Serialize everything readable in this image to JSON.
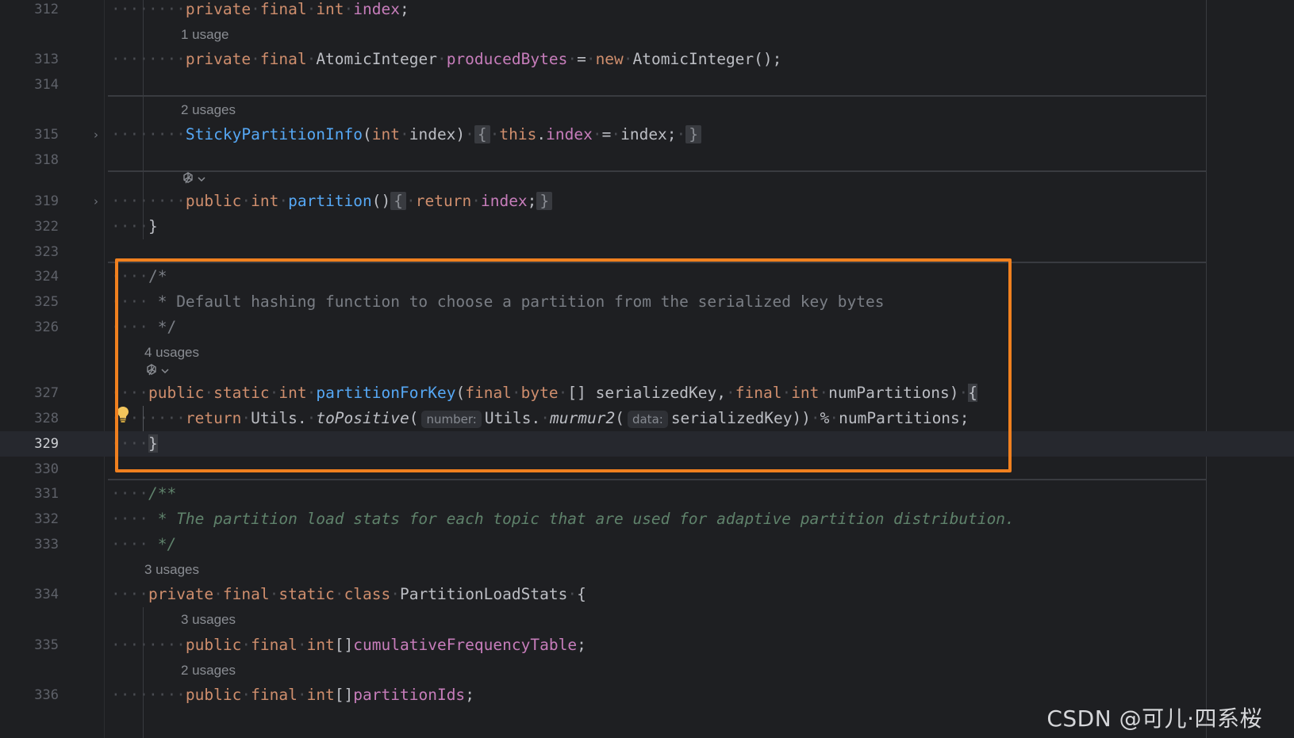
{
  "editor": {
    "lines": [
      {
        "num": "312",
        "indent": 2,
        "tokens": [
          [
            "kw",
            "private"
          ],
          [
            "kw",
            "final"
          ],
          [
            "kw",
            "int"
          ],
          [
            "fld",
            "index"
          ],
          [
            "p",
            ";"
          ]
        ]
      },
      {
        "num": "313",
        "indent": 2,
        "tokens": [
          [
            "kw",
            "private"
          ],
          [
            "kw",
            "final"
          ],
          [
            "p",
            "AtomicInteger"
          ],
          [
            "fld",
            "producedBytes"
          ],
          [
            "p",
            "="
          ],
          [
            "kw",
            "new"
          ],
          [
            "p",
            "AtomicInteger();"
          ]
        ]
      },
      {
        "num": "314"
      },
      {
        "num": "315",
        "indent": 2,
        "fold": true,
        "tokens": [
          [
            "fn",
            "StickyPartitionInfo"
          ],
          [
            "p",
            "("
          ],
          [
            "kw",
            "int"
          ],
          [
            "p",
            "index)"
          ],
          [
            "fb",
            "{"
          ],
          [
            "kw",
            "this"
          ],
          [
            "p",
            "."
          ],
          [
            "fld",
            "index"
          ],
          [
            "p",
            "="
          ],
          [
            "p",
            "index;"
          ],
          [
            "fb",
            "}"
          ]
        ]
      },
      {
        "num": "318"
      },
      {
        "num": "319",
        "indent": 2,
        "fold": true,
        "tokens": [
          [
            "kw",
            "public"
          ],
          [
            "kw",
            "int"
          ],
          [
            "fn",
            "partition"
          ],
          [
            "p",
            "()"
          ],
          [
            "fb",
            "{"
          ],
          [
            "kw",
            "return"
          ],
          [
            "fld",
            "index"
          ],
          [
            "p",
            ";"
          ],
          [
            "fb",
            "}"
          ]
        ]
      },
      {
        "num": "322",
        "indent": 1,
        "tokens": [
          [
            "p",
            "}"
          ]
        ]
      },
      {
        "num": "323"
      },
      {
        "num": "324",
        "indent": 1,
        "tokens": [
          [
            "cmt",
            "/*"
          ]
        ]
      },
      {
        "num": "325",
        "indent": 1,
        "tokens": [
          [
            "cmt",
            " * Default hashing function to choose a partition from the serialized key bytes"
          ]
        ]
      },
      {
        "num": "326",
        "indent": 1,
        "tokens": [
          [
            "cmt",
            " */"
          ]
        ]
      },
      {
        "num": "327",
        "indent": 1,
        "tokens": [
          [
            "kw",
            "public"
          ],
          [
            "kw",
            "static"
          ],
          [
            "kw",
            "int"
          ],
          [
            "fn",
            "partitionForKey"
          ],
          [
            "p",
            "("
          ],
          [
            "kw",
            "final"
          ],
          [
            "kw",
            "byte"
          ],
          [
            "p",
            "[] serializedKey,"
          ],
          [
            "kw",
            "final"
          ],
          [
            "kw",
            "int"
          ],
          [
            "p",
            "numPartitions)"
          ],
          [
            "brace",
            "{"
          ]
        ]
      },
      {
        "num": "328",
        "indent": 2,
        "tokens": [
          [
            "kw",
            "return"
          ],
          [
            "p",
            "Utils."
          ],
          [
            "it",
            "toPositive"
          ],
          [
            "p",
            "("
          ],
          [
            "hint",
            "number:"
          ],
          [
            "p",
            "Utils."
          ],
          [
            "it",
            "murmur2"
          ],
          [
            "p",
            "("
          ],
          [
            "hint",
            "data:"
          ],
          [
            "p",
            "serializedKey))"
          ],
          [
            "p",
            "%"
          ],
          [
            "p",
            "numPartitions;"
          ]
        ]
      },
      {
        "num": "329",
        "indent": 1,
        "current": true,
        "tokens": [
          [
            "brace",
            "}"
          ]
        ]
      },
      {
        "num": "330"
      },
      {
        "num": "331",
        "indent": 1,
        "tokens": [
          [
            "doc",
            "/**"
          ]
        ]
      },
      {
        "num": "332",
        "indent": 1,
        "tokens": [
          [
            "doc",
            " * The partition load stats for each topic that are used for adaptive partition distribution."
          ]
        ]
      },
      {
        "num": "333",
        "indent": 1,
        "tokens": [
          [
            "doc",
            " */"
          ]
        ]
      },
      {
        "num": "334",
        "indent": 1,
        "tokens": [
          [
            "kw",
            "private"
          ],
          [
            "kw",
            "final"
          ],
          [
            "kw",
            "static"
          ],
          [
            "kw",
            "class"
          ],
          [
            "p",
            "PartitionLoadStats"
          ],
          [
            "p",
            "{"
          ]
        ]
      },
      {
        "num": "335",
        "indent": 2,
        "tokens": [
          [
            "kw",
            "public"
          ],
          [
            "kw",
            "final"
          ],
          [
            "kw",
            "int"
          ],
          [
            "p",
            "[]"
          ],
          [
            "fld",
            "cumulativeFrequencyTable"
          ],
          [
            "p",
            ";"
          ]
        ]
      },
      {
        "num": "336",
        "indent": 2,
        "tokens": [
          [
            "kw",
            "public"
          ],
          [
            "kw",
            "final"
          ],
          [
            "kw",
            "int"
          ],
          [
            "p",
            "[]"
          ],
          [
            "fld",
            "partitionIds"
          ],
          [
            "p",
            ";"
          ]
        ]
      }
    ],
    "usages": {
      "u313": "1 usage",
      "u315": "2 usages",
      "u327": "4 usages",
      "u334": "3 usages",
      "u335": "3 usages",
      "u336": "2 usages"
    },
    "ai_icon": "ai-assistant-icon",
    "colors": {
      "highlight_border": "#f0801f",
      "keyword": "#cf8e6d",
      "field": "#c77dbb",
      "function": "#56a8f5",
      "doc_comment": "#5f826b"
    }
  },
  "watermark": "CSDN @可儿·四系桜"
}
